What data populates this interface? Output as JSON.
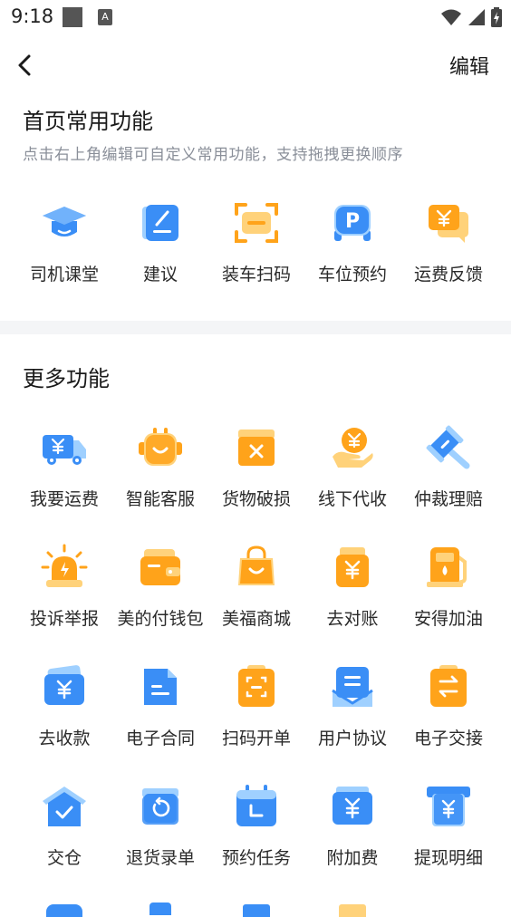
{
  "status": {
    "time": "9:18"
  },
  "header": {
    "edit_label": "编辑"
  },
  "home_section": {
    "title": "首页常用功能",
    "subtitle": "点击右上角编辑可自定义常用功能，支持拖拽更换顺序",
    "items": [
      {
        "label": "司机课堂",
        "icon": "graduation-cap-icon"
      },
      {
        "label": "建议",
        "icon": "pencil-note-icon"
      },
      {
        "label": "装车扫码",
        "icon": "scan-icon"
      },
      {
        "label": "车位预约",
        "icon": "parking-icon"
      },
      {
        "label": "运费反馈",
        "icon": "yuan-chat-icon"
      }
    ]
  },
  "more_section": {
    "title": "更多功能",
    "rows": [
      [
        {
          "label": "我要运费",
          "icon": "yuan-truck-icon"
        },
        {
          "label": "智能客服",
          "icon": "robot-icon"
        },
        {
          "label": "货物破损",
          "icon": "damaged-box-icon"
        },
        {
          "label": "线下代收",
          "icon": "hand-coin-icon"
        },
        {
          "label": "仲裁理赔",
          "icon": "gavel-icon"
        }
      ],
      [
        {
          "label": "投诉举报",
          "icon": "alarm-light-icon"
        },
        {
          "label": "美的付钱包",
          "icon": "wallet-icon"
        },
        {
          "label": "美福商城",
          "icon": "shopping-bag-icon"
        },
        {
          "label": "去对账",
          "icon": "yuan-jar-icon"
        },
        {
          "label": "安得加油",
          "icon": "fuel-pump-icon"
        }
      ],
      [
        {
          "label": "去收款",
          "icon": "yuan-card-icon"
        },
        {
          "label": "电子合同",
          "icon": "document-icon"
        },
        {
          "label": "扫码开单",
          "icon": "scan-order-icon"
        },
        {
          "label": "用户协议",
          "icon": "agreement-icon"
        },
        {
          "label": "电子交接",
          "icon": "exchange-icon"
        }
      ],
      [
        {
          "label": "交仓",
          "icon": "warehouse-check-icon"
        },
        {
          "label": "退货录单",
          "icon": "return-icon"
        },
        {
          "label": "预约任务",
          "icon": "calendar-icon"
        },
        {
          "label": "附加费",
          "icon": "yuan-bill-icon"
        },
        {
          "label": "提现明细",
          "icon": "withdraw-icon"
        }
      ]
    ]
  },
  "colors": {
    "blue": "#3a8ef6",
    "blue_light": "#9fd0ff",
    "orange": "#ffa31a",
    "orange_light": "#ffd27a",
    "divider": "#f4f5f7"
  }
}
